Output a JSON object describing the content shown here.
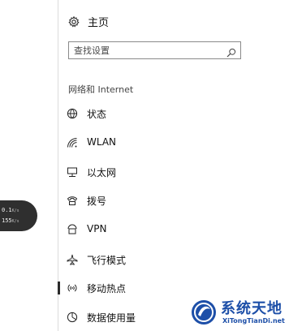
{
  "home": {
    "label": "主页",
    "icon": "gear-icon"
  },
  "search": {
    "placeholder": "查找设置",
    "value": ""
  },
  "section": {
    "title": "网络和 Internet"
  },
  "nav": {
    "items": [
      {
        "label": "状态",
        "icon": "globe-icon",
        "selected": false
      },
      {
        "label": "WLAN",
        "icon": "wifi-icon",
        "selected": false
      },
      {
        "label": "以太网",
        "icon": "ethernet-icon",
        "selected": false
      },
      {
        "label": "拨号",
        "icon": "dial-up-icon",
        "selected": false
      },
      {
        "label": "VPN",
        "icon": "vpn-icon",
        "selected": false
      },
      {
        "label": "飞行模式",
        "icon": "airplane-icon",
        "selected": false
      },
      {
        "label": "移动热点",
        "icon": "hotspot-icon",
        "selected": true
      },
      {
        "label": "数据使用量",
        "icon": "data-usage-icon",
        "selected": false
      }
    ]
  },
  "speed_widget": {
    "upload_value": "0.1",
    "upload_unit": "K/s",
    "download_value": "155",
    "download_unit": "K/s"
  },
  "watermark": {
    "title": "系统天地",
    "subtitle": "XiTongTianDi.net"
  },
  "colors": {
    "selected_bar": "#2b2b2b",
    "watermark_blue": "#1d4fa8"
  }
}
